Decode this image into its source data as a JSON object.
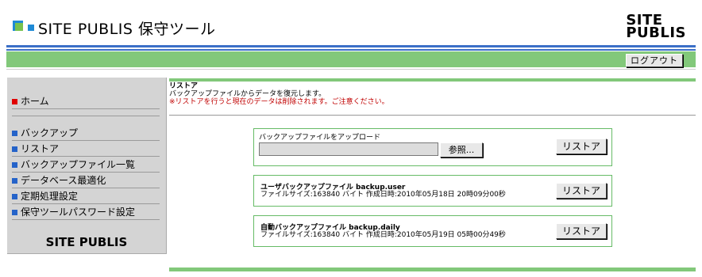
{
  "header": {
    "title": "SITE PUBLIS 保守ツール",
    "brand_line1": "SITE",
    "brand_line2": "PUBLIS",
    "logout_label": "ログアウト"
  },
  "sidebar": {
    "home_label": "ホーム",
    "items": [
      {
        "label": "バックアップ"
      },
      {
        "label": "リストア"
      },
      {
        "label": "バックアップファイル一覧"
      },
      {
        "label": "データベース最適化"
      },
      {
        "label": "定期処理設定"
      },
      {
        "label": "保守ツールパスワード設定"
      }
    ],
    "brand": "SITE PUBLIS"
  },
  "content": {
    "title": "リストア",
    "description": "バックアップファイルからデータを復元します。",
    "warning": "※リストアを行うと現在のデータは削除されます。ご注意ください。",
    "upload": {
      "label": "バックアップファイルをアップロード",
      "file_value": "",
      "browse_label": "参照...",
      "restore_label": "リストア"
    },
    "backups": [
      {
        "name": "ユーザバックアップファイル backup.user",
        "info": "ファイルサイズ:163840 バイト 作成日時:2010年05月18日 20時09分00秒",
        "restore_label": "リストア"
      },
      {
        "name": "自動バックアップファイル backup.daily",
        "info": "ファイルサイズ:163840 バイト 作成日時:2010年05月19日 05時00分49秒",
        "restore_label": "リストア"
      }
    ]
  },
  "colors": {
    "accent_green": "#82c87a",
    "accent_blue": "#3b6fc7",
    "warning_red": "#c00000",
    "home_marker": "#e00000",
    "menu_marker": "#2563c9"
  }
}
